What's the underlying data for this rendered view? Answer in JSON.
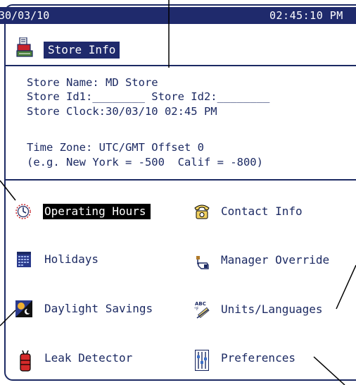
{
  "status_bar": {
    "date": "30/03/10",
    "time": "02:45:10 PM"
  },
  "screen": {
    "title": "Store Info",
    "title_icon": "store-terminal-icon"
  },
  "store_info": {
    "name_line": "Store Name: MD Store",
    "id_line": "Store Id1:________ Store Id2:________",
    "clock_line": "Store Clock:30/03/10 02:45 PM",
    "timezone_line": "Time Zone: UTC/GMT Offset 0",
    "example_line": "(e.g. New York = -500  Calif = -800)"
  },
  "menu": {
    "left": [
      {
        "label": "Operating Hours",
        "icon": "clock-icon",
        "selected": true
      },
      {
        "label": "Holidays",
        "icon": "calendar-icon",
        "selected": false
      },
      {
        "label": "Daylight Savings",
        "icon": "sun-moon-icon",
        "selected": false
      },
      {
        "label": "Leak Detector",
        "icon": "leak-detector-icon",
        "selected": false
      }
    ],
    "right": [
      {
        "label": "Contact Info",
        "icon": "telephone-icon",
        "selected": false
      },
      {
        "label": "Manager Override",
        "icon": "hand-key-icon",
        "selected": false
      },
      {
        "label": "Units/Languages",
        "icon": "abc-units-icon",
        "selected": false
      },
      {
        "label": "Preferences",
        "icon": "preferences-icon",
        "selected": false
      }
    ]
  },
  "colors": {
    "navy": "#1f2a6c",
    "text": "#1c2a63",
    "selected_bg": "#000000"
  }
}
